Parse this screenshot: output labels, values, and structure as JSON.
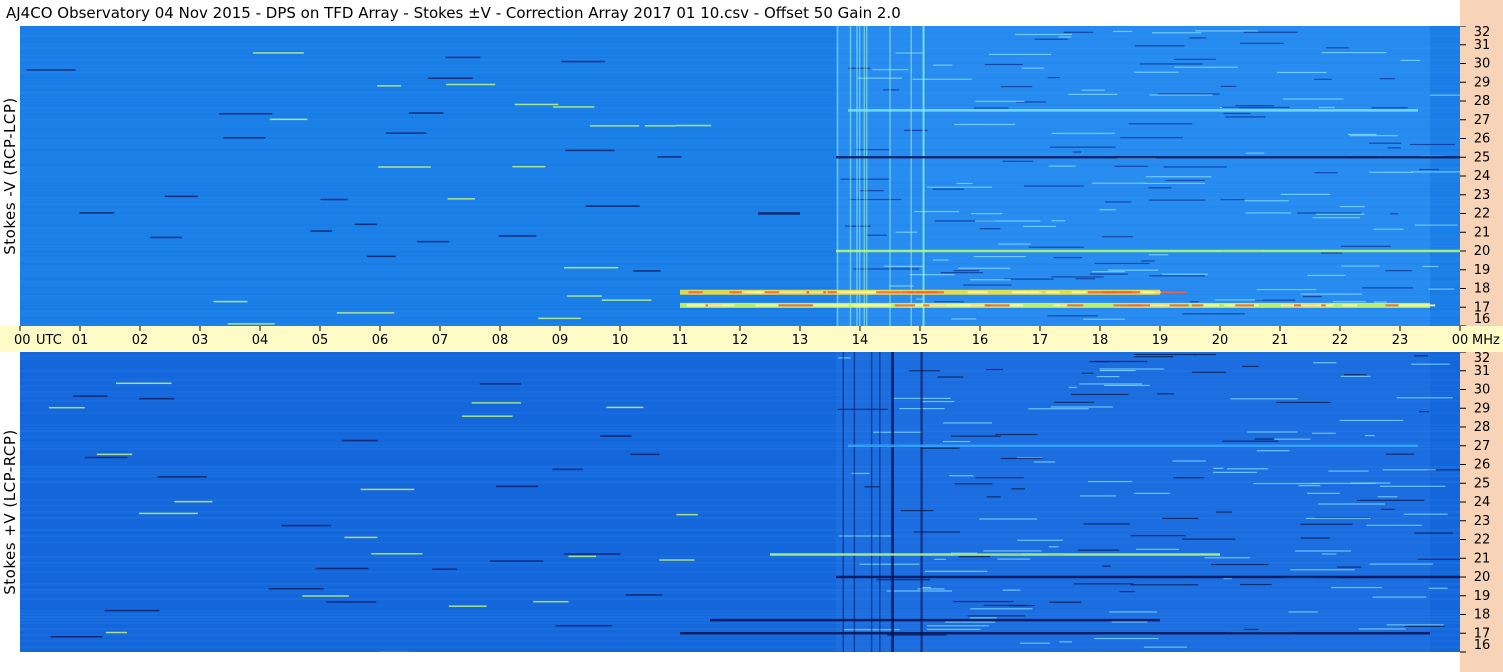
{
  "title": "AJ4CO Observatory  04 Nov 2015  -  DPS on TFD Array  -  Stokes ±V  -  Correction Array 2017 01 10.csv  -  Offset 50  Gain 2.0",
  "chart_data": {
    "type": "heatmap",
    "title": "AJ4CO Observatory  04 Nov 2015  -  DPS on TFD Array  -  Stokes ±V  -  Correction Array 2017 01 10.csv  -  Offset 50  Gain 2.0",
    "x_axis": {
      "unit_label": "UTC",
      "ticks": [
        "00",
        "01",
        "02",
        "03",
        "04",
        "05",
        "06",
        "07",
        "08",
        "09",
        "10",
        "11",
        "12",
        "13",
        "14",
        "15",
        "16",
        "17",
        "18",
        "19",
        "20",
        "21",
        "22",
        "23",
        "00"
      ],
      "range_hours": [
        0,
        24
      ]
    },
    "y_axis": {
      "unit_label": "MHz",
      "ticks": [
        16,
        17,
        18,
        19,
        20,
        21,
        22,
        23,
        24,
        25,
        26,
        27,
        28,
        29,
        30,
        31,
        32
      ],
      "range_mhz": [
        16,
        32
      ]
    },
    "panels": [
      {
        "label": "Stokes -V (RCP-LCP)",
        "base_color": "#1b7fe8",
        "features": [
          {
            "kind": "broadband_activity",
            "start_utc": 13.6,
            "end_utc": 23.5
          },
          {
            "kind": "intense_band",
            "freq_mhz": 17.8,
            "start_utc": 11.0,
            "end_utc": 19.0,
            "color": "#ffeb3b"
          },
          {
            "kind": "intense_band",
            "freq_mhz": 17.1,
            "start_utc": 11.0,
            "end_utc": 23.5,
            "color": "#d8ff50"
          },
          {
            "kind": "band",
            "freq_mhz": 27.5,
            "start_utc": 13.8,
            "end_utc": 23.3,
            "color": "#7fe8ff"
          },
          {
            "kind": "band",
            "freq_mhz": 20.0,
            "start_utc": 13.6,
            "end_utc": 24.0,
            "color": "#b8ff70"
          },
          {
            "kind": "dark_band",
            "freq_mhz": 25.0,
            "start_utc": 13.6,
            "end_utc": 24.0,
            "color": "#0a1a60"
          },
          {
            "kind": "dark_band",
            "freq_mhz": 22.0,
            "start_utc": 12.3,
            "end_utc": 13.0,
            "color": "#0a1a60"
          }
        ]
      },
      {
        "label": "Stokes +V (LCP-RCP)",
        "base_color": "#1567dc",
        "features": [
          {
            "kind": "broadband_activity",
            "start_utc": 13.6,
            "end_utc": 23.5
          },
          {
            "kind": "dark_band",
            "freq_mhz": 17.7,
            "start_utc": 11.5,
            "end_utc": 19.0,
            "color": "#071050"
          },
          {
            "kind": "dark_band",
            "freq_mhz": 17.0,
            "start_utc": 11.0,
            "end_utc": 23.5,
            "color": "#071050"
          },
          {
            "kind": "band",
            "freq_mhz": 27.0,
            "start_utc": 13.8,
            "end_utc": 23.3,
            "color": "#3aa8ff"
          },
          {
            "kind": "band",
            "freq_mhz": 21.2,
            "start_utc": 12.5,
            "end_utc": 20.0,
            "color": "#b8ff70"
          },
          {
            "kind": "dark_band",
            "freq_mhz": 20.0,
            "start_utc": 13.6,
            "end_utc": 24.0,
            "color": "#071050"
          }
        ]
      }
    ]
  }
}
